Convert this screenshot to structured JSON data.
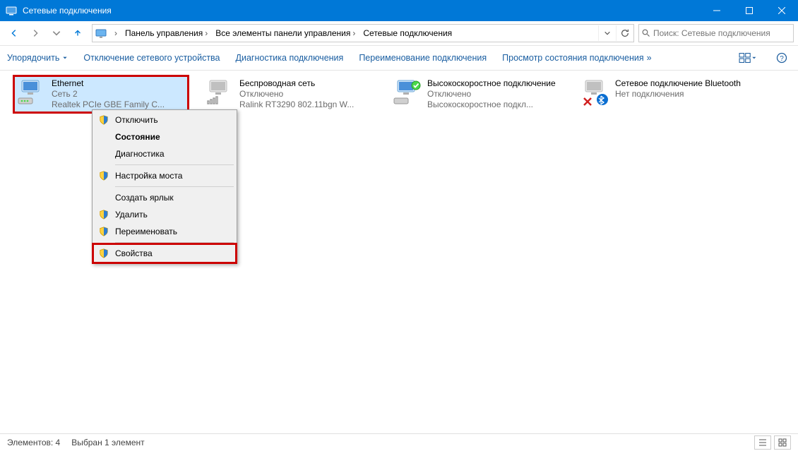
{
  "window": {
    "title": "Сетевые подключения"
  },
  "breadcrumbs": {
    "items": [
      "Панель управления",
      "Все элементы панели управления",
      "Сетевые подключения"
    ]
  },
  "search": {
    "placeholder": "Поиск: Сетевые подключения"
  },
  "toolbar": {
    "organize": "Упорядочить",
    "disable": "Отключение сетевого устройства",
    "diagnose": "Диагностика подключения",
    "rename": "Переименование подключения",
    "status": "Просмотр состояния подключения"
  },
  "connections": [
    {
      "name": "Ethernet",
      "status": "Сеть  2",
      "device": "Realtek PCIe GBE Family C..."
    },
    {
      "name": "Беспроводная сеть",
      "status": "Отключено",
      "device": "Ralink RT3290 802.11bgn W..."
    },
    {
      "name": "Высокоскоростное подключение",
      "status": "Отключено",
      "device": "Высокоскоростное подкл..."
    },
    {
      "name": "Сетевое подключение Bluetooth",
      "status": "Нет подключения",
      "device": ""
    }
  ],
  "context_menu": {
    "disable": "Отключить",
    "state": "Состояние",
    "diag": "Диагностика",
    "bridge": "Настройка моста",
    "shortcut": "Создать ярлык",
    "delete": "Удалить",
    "rename": "Переименовать",
    "props": "Свойства"
  },
  "statusbar": {
    "elements": "Элементов: 4",
    "selected": "Выбран 1 элемент"
  }
}
